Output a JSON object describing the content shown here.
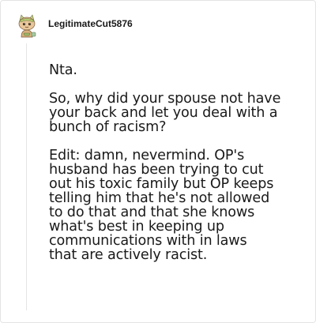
{
  "comment": {
    "author": "LegitimateCut5876",
    "avatar_icon": "snoo-avatar-icon",
    "paragraphs": [
      "Nta.",
      "So, why did your spouse not have\nyour back and let you deal with a\nbunch of racism?",
      "Edit: damn, nevermind. OP's\nhusband has been trying to cut\nout his toxic family but OP keeps\ntelling him that he's not allowed\nto do that and that she knows\nwhat's best in keeping up\ncommunications with in laws\nthat are actively racist."
    ]
  }
}
